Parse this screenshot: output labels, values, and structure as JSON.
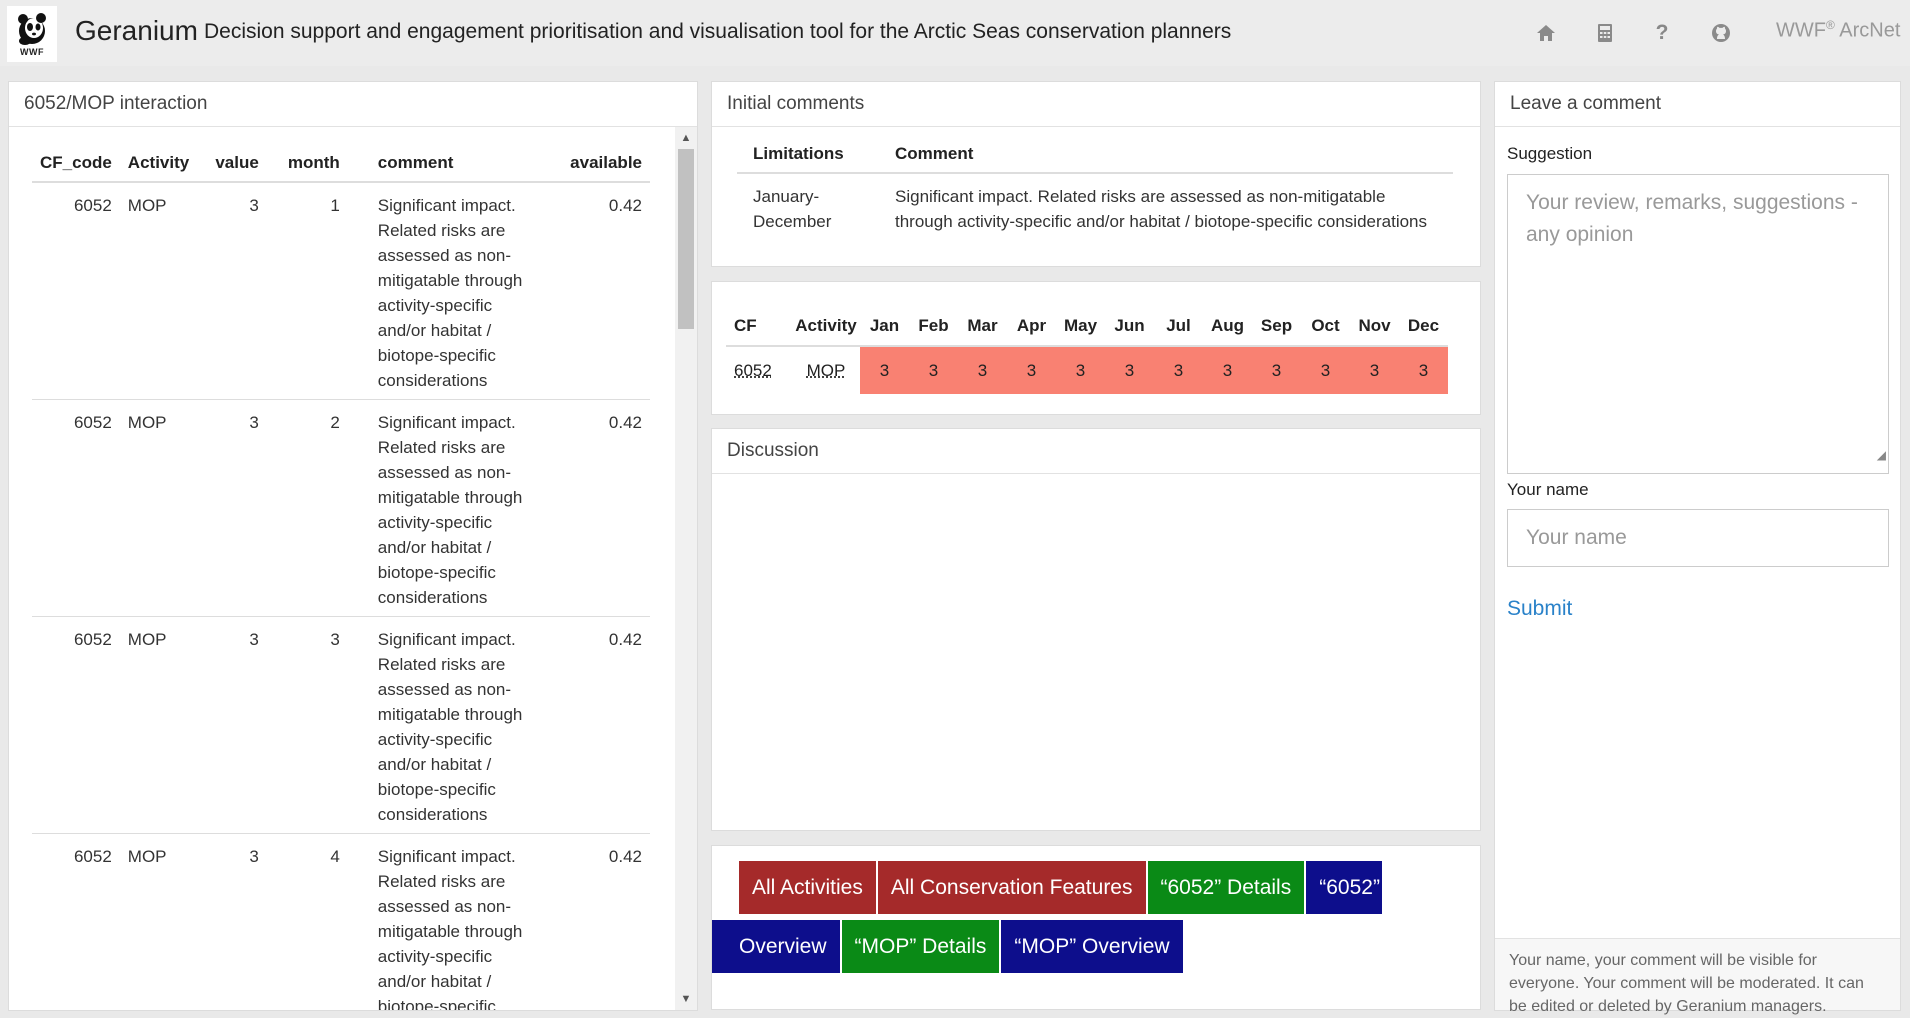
{
  "header": {
    "logo_text": "WWF",
    "title": "Geranium",
    "subtitle": "Decision support and engagement prioritisation and visualisation tool for the Arctic Seas conservation planners",
    "brand_prefix": "WWF",
    "brand_sup": "®",
    "brand_suffix": " ArcNet",
    "icons": [
      "home-icon",
      "calculator-icon",
      "help-icon",
      "github-icon"
    ]
  },
  "left_panel": {
    "title": "6052/MOP interaction",
    "columns": [
      "CF_code",
      "Activity",
      "value",
      "month",
      "comment",
      "available"
    ],
    "rows": [
      {
        "cf_code": "6052",
        "activity": "MOP",
        "value": "3",
        "month": "1",
        "comment": "Significant impact. Related risks are assessed as non-mitigatable through activity-specific and/or habitat / biotope-specific considerations",
        "available": "0.42"
      },
      {
        "cf_code": "6052",
        "activity": "MOP",
        "value": "3",
        "month": "2",
        "comment": "Significant impact. Related risks are assessed as non-mitigatable through activity-specific and/or habitat / biotope-specific considerations",
        "available": "0.42"
      },
      {
        "cf_code": "6052",
        "activity": "MOP",
        "value": "3",
        "month": "3",
        "comment": "Significant impact. Related risks are assessed as non-mitigatable through activity-specific and/or habitat / biotope-specific considerations",
        "available": "0.42"
      },
      {
        "cf_code": "6052",
        "activity": "MOP",
        "value": "3",
        "month": "4",
        "comment": "Significant impact. Related risks are assessed as non-mitigatable through activity-specific and/or habitat / biotope-specific considerations",
        "available": "0.42"
      }
    ]
  },
  "initial_comments": {
    "title": "Initial comments",
    "col_limitations": "Limitations",
    "col_comment": "Comment",
    "limitations": "January-December",
    "comment": "Significant impact. Related risks are assessed as non-mitigatable through activity-specific and/or habitat / biotope-specific considerations"
  },
  "monthly": {
    "col_cf": "CF",
    "col_activity": "Activity",
    "months": [
      "Jan",
      "Feb",
      "Mar",
      "Apr",
      "May",
      "Jun",
      "Jul",
      "Aug",
      "Sep",
      "Oct",
      "Nov",
      "Dec"
    ],
    "cf": "6052",
    "activity": "MOP",
    "values": [
      "3",
      "3",
      "3",
      "3",
      "3",
      "3",
      "3",
      "3",
      "3",
      "3",
      "3",
      "3"
    ],
    "cell_color": "#f98172"
  },
  "discussion": {
    "title": "Discussion"
  },
  "nav_buttons": {
    "all_activities": "All Activities",
    "all_features": "All Conservation Features",
    "cf_details": "“6052” Details",
    "cf_overview_part1": "“6052”",
    "cf_overview_part2": "Overview",
    "activity_details": "“MOP” Details",
    "activity_overview": "“MOP” Overview",
    "colors": {
      "red": "#a52a2a",
      "green": "#0a8a16",
      "blue": "#0d0e8c"
    }
  },
  "comment_form": {
    "title": "Leave a comment",
    "suggestion_label": "Suggestion",
    "suggestion_placeholder": "Your review, remarks, suggestions - any opinion",
    "name_label": "Your name",
    "name_placeholder": "Your name",
    "submit_label": "Submit",
    "disclaimer": "Your name, your comment will be visible for everyone. Your comment will be moderated. It can be edited or deleted by Geranium managers."
  }
}
